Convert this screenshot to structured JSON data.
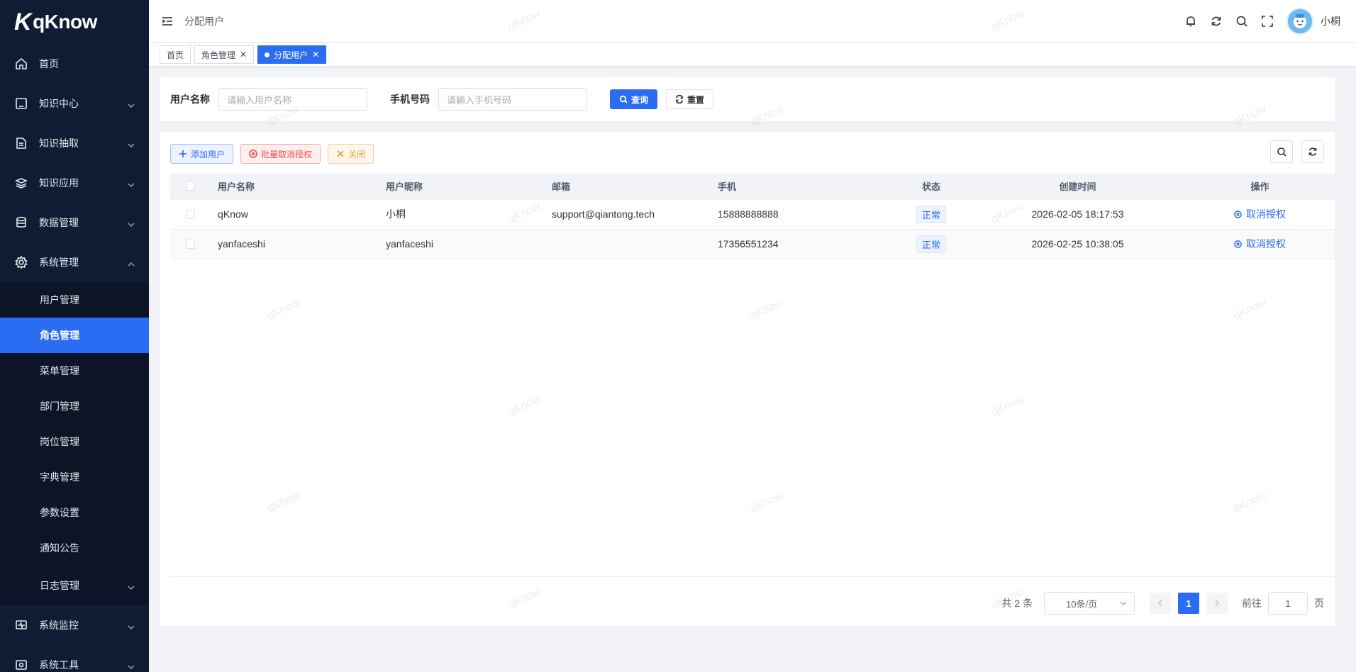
{
  "app": {
    "logo_text": "qKnow",
    "logo_mark": "K"
  },
  "sidebar": {
    "items": [
      {
        "label": "首页",
        "icon": "home-icon"
      },
      {
        "label": "知识中心",
        "icon": "book-icon"
      },
      {
        "label": "知识抽取",
        "icon": "document-icon"
      },
      {
        "label": "知识应用",
        "icon": "layers-icon"
      },
      {
        "label": "数据管理",
        "icon": "database-icon"
      },
      {
        "label": "系统管理",
        "icon": "gear-icon"
      }
    ],
    "submenu": [
      "用户管理",
      "角色管理",
      "菜单管理",
      "部门管理",
      "岗位管理",
      "字典管理",
      "参数设置",
      "通知公告",
      "日志管理"
    ],
    "bottom_items": [
      {
        "label": "系统监控",
        "icon": "monitor-icon"
      },
      {
        "label": "系统工具",
        "icon": "tools-icon"
      }
    ]
  },
  "header": {
    "breadcrumb": "分配用户",
    "username": "小桐"
  },
  "tags": [
    {
      "label": "首页"
    },
    {
      "label": "角色管理"
    },
    {
      "label": "分配用户"
    }
  ],
  "search": {
    "username_label": "用户名称",
    "username_placeholder": "请输入用户名称",
    "phone_label": "手机号码",
    "phone_placeholder": "请输入手机号码",
    "query_label": "查询",
    "reset_label": "重置"
  },
  "toolbar": {
    "add_label": "添加用户",
    "batch_revoke_label": "批量取消授权",
    "close_label": "关闭"
  },
  "table": {
    "columns": [
      "用户名称",
      "用户昵称",
      "邮箱",
      "手机",
      "状态",
      "创建时间",
      "操作"
    ],
    "rows": [
      {
        "username": "qKnow",
        "nickname": "小桐",
        "email": "support@qiantong.tech",
        "phone": "15888888888",
        "status": "正常",
        "created": "2026-02-05 18:17:53",
        "action": "取消授权"
      },
      {
        "username": "yanfaceshi",
        "nickname": "yanfaceshi",
        "email": "",
        "phone": "17356551234",
        "status": "正常",
        "created": "2026-02-25 10:38:05",
        "action": "取消授权"
      }
    ]
  },
  "pagination": {
    "total": "共 2 条",
    "page_size": "10条/页",
    "current": "1",
    "goto_label": "前往",
    "goto_value": "1",
    "page_suffix": "页"
  },
  "watermark": "qKnow",
  "colors": {
    "primary": "#2b6df2",
    "sidebar_bg": "#0f1c33",
    "danger": "#f04a4a",
    "warning": "#e6a23c"
  }
}
